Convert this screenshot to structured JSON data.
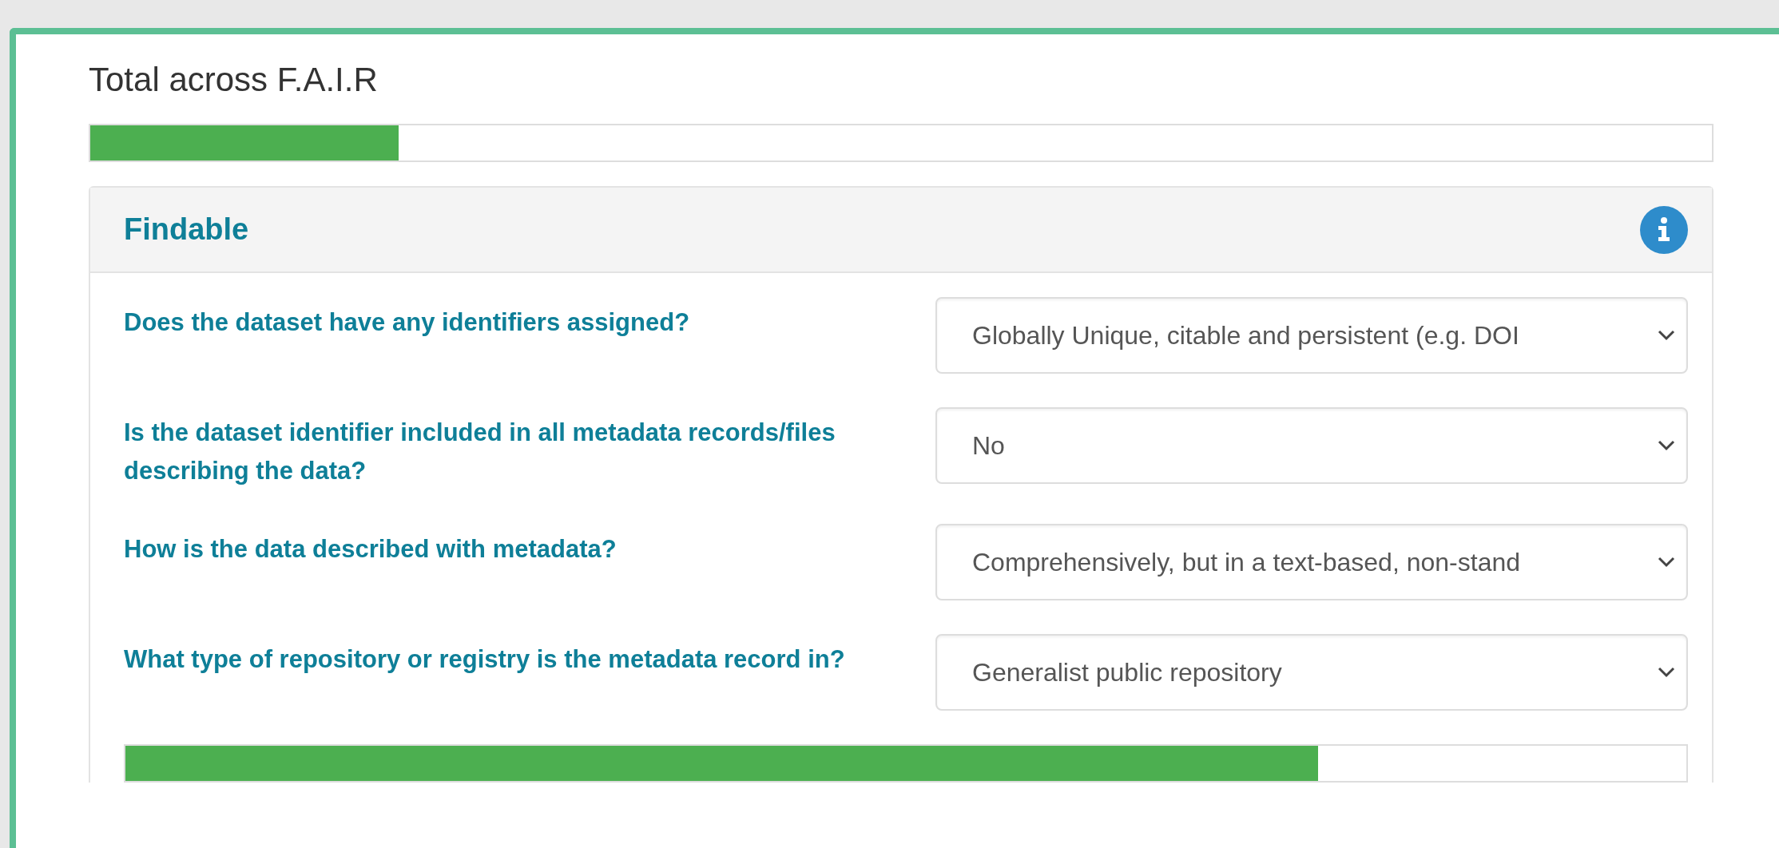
{
  "title": "Total across F.A.I.R",
  "total_progress": {
    "level": 0.19
  },
  "section": {
    "title": "Findable",
    "questions": [
      {
        "label": "Does the dataset have any identifiers assigned?",
        "value": "Globally Unique, citable and persistent (e.g. DOI"
      },
      {
        "label": "Is the dataset identifier included in all metadata records/files describing the data?",
        "value": "No"
      },
      {
        "label": "How is the data described with metadata?",
        "value": "Comprehensively, but in a text-based, non-stand"
      },
      {
        "label": "What type of repository or registry is the metadata record in?",
        "value": "Generalist public repository"
      }
    ],
    "progress": {
      "level": 0.764
    }
  }
}
